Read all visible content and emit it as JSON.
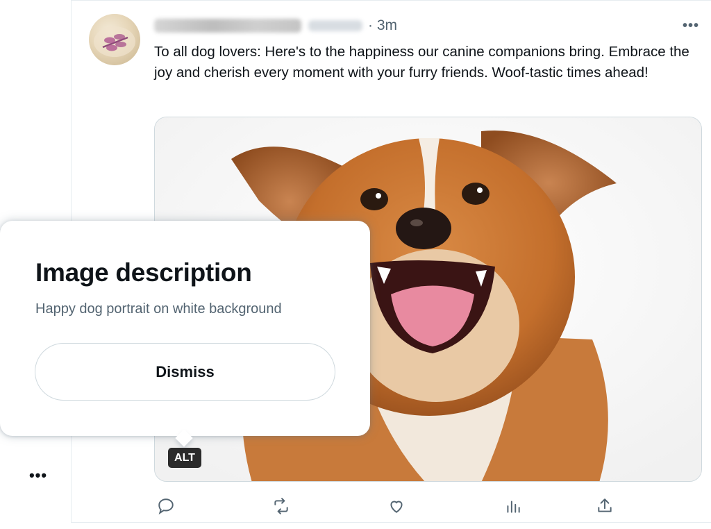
{
  "tweet": {
    "time": "· 3m",
    "text": "To all dog lovers: Here's to the happiness our canine companions bring. Embrace the joy and cherish every moment with your furry friends. Woof-tastic times ahead!",
    "more_icon": "more-horizontal-icon",
    "media_alt_badge": "ALT"
  },
  "popover": {
    "title": "Image description",
    "description": "Happy dog portrait on white background",
    "dismiss_label": "Dismiss"
  },
  "rail": {
    "more_icon": "more-horizontal-icon"
  },
  "actions": [
    {
      "name": "reply",
      "icon": "reply-icon"
    },
    {
      "name": "retweet",
      "icon": "retweet-icon"
    },
    {
      "name": "like",
      "icon": "heart-icon"
    },
    {
      "name": "views",
      "icon": "analytics-icon"
    },
    {
      "name": "share",
      "icon": "share-icon"
    }
  ],
  "colors": {
    "text_primary": "#0f1419",
    "text_secondary": "#536471",
    "border": "#cfd9de",
    "badge_bg": "#2b2b2b"
  }
}
